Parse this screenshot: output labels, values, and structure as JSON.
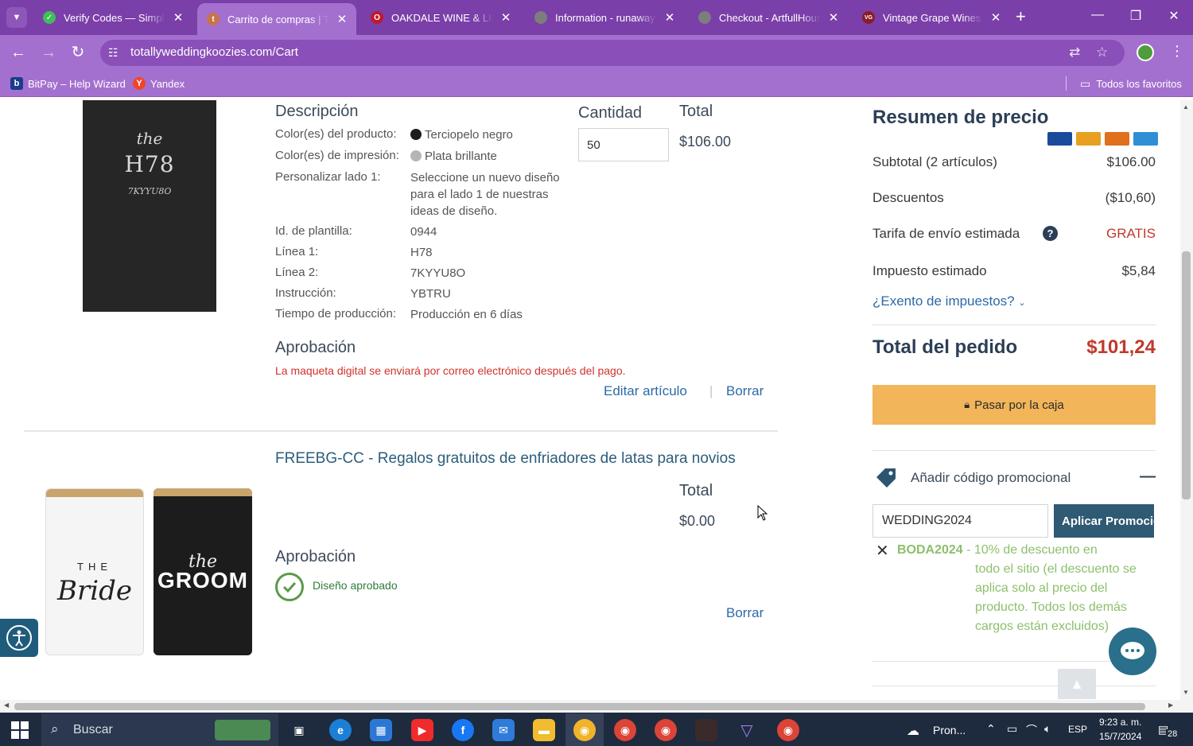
{
  "browser": {
    "tabs": [
      {
        "title": "Verify Codes — SimplyCodes",
        "favicon_color": "#3fbf5a",
        "favicon_glyph": "✓",
        "active": false
      },
      {
        "title": "Carrito de compras | Totally Wedding Koozies",
        "favicon_color": "#c8734a",
        "favicon_glyph": "t",
        "active": true
      },
      {
        "title": "OAKDALE WINE & LIQUOR",
        "favicon_color": "#c0182c",
        "favicon_glyph": "O",
        "active": false
      },
      {
        "title": "Information - runawaythreads",
        "favicon_color": "#7d7d7d",
        "favicon_glyph": "",
        "active": false
      },
      {
        "title": "Checkout - ArtfullHouse",
        "favicon_color": "#7d7d7d",
        "favicon_glyph": "",
        "active": false
      },
      {
        "title": "Vintage Grape Wines and Spirits",
        "favicon_color": "#8a1d2a",
        "favicon_glyph": "VG",
        "active": false
      }
    ],
    "url": "totallyweddingkoozies.com/Cart",
    "bookmarks": [
      {
        "label": "BitPay – Help Wizard",
        "icon_color": "#1a3c8c",
        "glyph": "b"
      },
      {
        "label": "Yandex",
        "icon_color": "#f0452a",
        "glyph": "Y"
      }
    ],
    "all_bookmarks_label": "Todos los favoritos"
  },
  "cart": {
    "item1": {
      "image_text": {
        "line1": "the",
        "line2": "H78",
        "line3": "7KYYU8O"
      },
      "description_heading": "Descripción",
      "quantity_heading": "Cantidad",
      "total_heading": "Total",
      "quantity_value": "50",
      "total_value": "$106.00",
      "rows": [
        {
          "label": "Color(es) del producto:",
          "value": "Terciopelo negro",
          "swatch": "#1d1d1d"
        },
        {
          "label": "Color(es) de impresión:",
          "value": "Plata brillante",
          "swatch": "#b5b5b5"
        },
        {
          "label": "Personalizar lado 1:",
          "value": "Seleccione un nuevo diseño para el lado 1 de nuestras ideas de diseño."
        },
        {
          "label": "Id. de plantilla:",
          "value": "0944"
        },
        {
          "label": "Línea 1:",
          "value": "H78"
        },
        {
          "label": "Línea 2:",
          "value": "7KYYU8O"
        },
        {
          "label": "Instrucción:",
          "value": "YBTRU"
        },
        {
          "label": "Tiempo de producción:",
          "value": "Producción en 6 días"
        }
      ],
      "approval_heading": "Aprobación",
      "approval_notice": "La maqueta digital se enviará por correo electrónico después del pago.",
      "edit_link": "Editar artículo",
      "separator": "|",
      "delete_link": "Borrar"
    },
    "item2": {
      "title": "FREEBG-CC - Regalos gratuitos de enfriadores de latas para novios",
      "total_heading": "Total",
      "total_value": "$0.00",
      "approval_heading": "Aprobación",
      "approved_text": "Diseño aprobado",
      "delete_link": "Borrar",
      "image_text": {
        "left_top": "THE",
        "left_script": "Bride",
        "right_script": "the",
        "right_main": "GROOM"
      }
    }
  },
  "summary": {
    "title": "Resumen de precio",
    "card_brands": [
      {
        "name": "visa",
        "color": "#1a4a9c"
      },
      {
        "name": "mastercard",
        "color": "#e8a020"
      },
      {
        "name": "discover",
        "color": "#e0701e"
      },
      {
        "name": "amex",
        "color": "#2f8fd4"
      }
    ],
    "subtotal_label": "Subtotal (2 artículos)",
    "subtotal_value": "$106.00",
    "discount_label": "Descuentos",
    "discount_value": "($10,60)",
    "shipping_label": "Tarifa de envío estimada",
    "shipping_value": "GRATIS",
    "tax_label": "Impuesto estimado",
    "tax_value": "$5,84",
    "tax_exempt_link": "¿Exento de impuestos?",
    "order_total_label": "Total del pedido",
    "order_total_value": "$101,24",
    "checkout_button": "Pasar por la caja",
    "promo_heading": "Añadir código promocional",
    "promo_collapse": "—",
    "promo_input_value": "WEDDING2024",
    "apply_button": "Aplicar Promoción",
    "applied_code": "BODA2024",
    "applied_code_desc_line1": "- 10% de descuento en",
    "applied_code_desc_rest": "todo el sitio (el descuento se aplica solo al precio del producto. Todos los demás cargos están excluidos)",
    "accent_color": "#c0392b"
  },
  "taskbar": {
    "search_placeholder": "Buscar",
    "weather": "Pron...",
    "language": "ESP",
    "time": "9:23 a. m.",
    "date": "15/7/2024",
    "notifications": "28"
  }
}
